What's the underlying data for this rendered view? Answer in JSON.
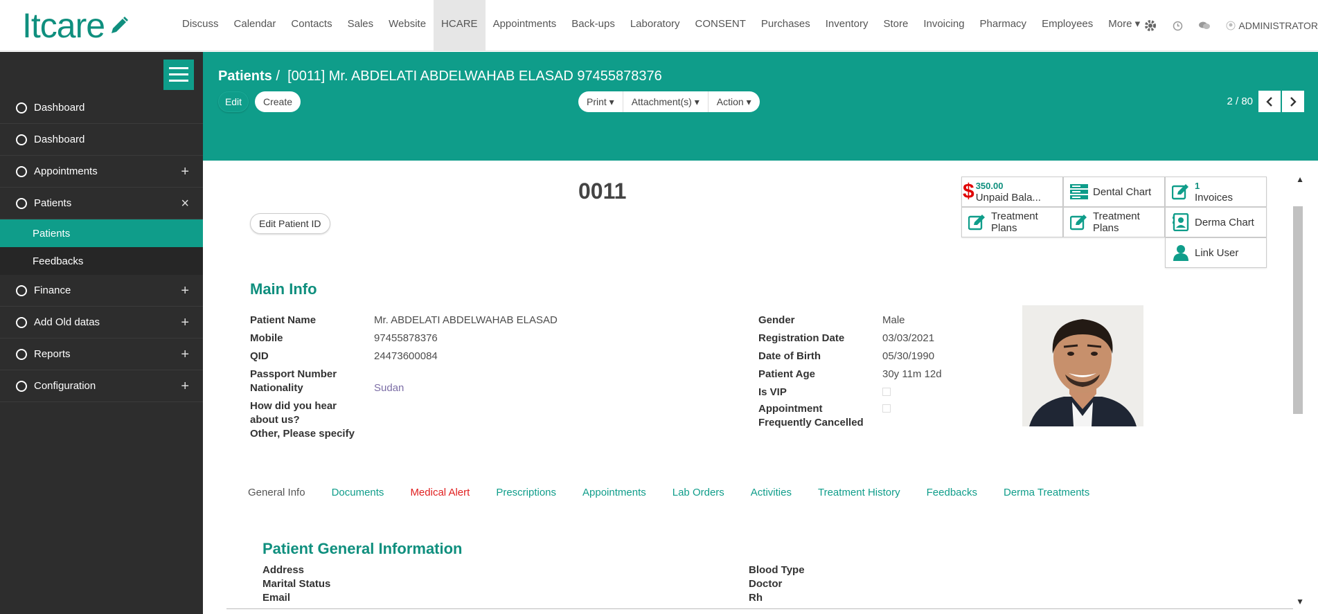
{
  "app": {
    "logo_text": "Itcare"
  },
  "topmenu": [
    "Discuss",
    "Calendar",
    "Contacts",
    "Sales",
    "Website",
    "HCARE",
    "Appointments",
    "Back-ups",
    "Laboratory",
    "CONSENT",
    "Purchases",
    "Inventory",
    "Store",
    "Invoicing",
    "Pharmacy",
    "Employees",
    "More ▾"
  ],
  "topmenu_active": "HCARE",
  "user": {
    "name": "ADMINISTRATOR"
  },
  "sidebar": {
    "items": [
      {
        "label": "Dashboard",
        "toggle": ""
      },
      {
        "label": "Dashboard",
        "toggle": ""
      },
      {
        "label": "Appointments",
        "toggle": "+"
      },
      {
        "label": "Patients",
        "toggle": "×"
      }
    ],
    "sub": [
      {
        "label": "Patients"
      },
      {
        "label": "Feedbacks"
      }
    ],
    "items2": [
      {
        "label": "Finance",
        "toggle": "+"
      },
      {
        "label": "Add Old datas",
        "toggle": "+"
      },
      {
        "label": "Reports",
        "toggle": "+"
      },
      {
        "label": "Configuration",
        "toggle": "+"
      }
    ]
  },
  "header": {
    "crumb_root": "Patients",
    "crumb_sep": "/",
    "crumb_current": "[0011] Mr. ABDELATI ABDELWAHAB ELASAD 97455878376",
    "edit_label": "Edit",
    "create_label": "Create",
    "print_label": "Print ▾",
    "attach_label": "Attachment(s) ▾",
    "action_label": "Action ▾",
    "pager": "2 / 80"
  },
  "record": {
    "patient_id": "0011",
    "edit_pid_label": "Edit Patient ID"
  },
  "smart_buttons": {
    "unpaid_amount": "350.00",
    "unpaid_label": "Unpaid Bala...",
    "dental_chart": "Dental Chart",
    "invoices_count": "1",
    "invoices_label": "Invoices",
    "treatment_plans_1": "Treatment Plans",
    "treatment_plans_2": "Treatment Plans",
    "derma_chart": "Derma Chart",
    "link_user": "Link User"
  },
  "main_info": {
    "title": "Main Info",
    "patient_name_label": "Patient Name",
    "patient_name": "Mr. ABDELATI ABDELWAHAB ELASAD",
    "mobile_label": "Mobile",
    "mobile": "97455878376",
    "qid_label": "QID",
    "qid": "24473600084",
    "passport_label": "Passport Number",
    "nationality_label": "Nationality",
    "nationality": "Sudan",
    "hear_label_1": "How did you hear",
    "hear_label_2": "about us?",
    "other_label": "Other, Please specify",
    "gender_label": "Gender",
    "gender": "Male",
    "reg_date_label": "Registration Date",
    "reg_date": "03/03/2021",
    "dob_label": "Date of Birth",
    "dob": "05/30/1990",
    "age_label": "Patient Age",
    "age": "30y 11m 12d",
    "vip_label": "Is VIP",
    "appt_cancel_label_1": "Appointment",
    "appt_cancel_label_2": "Frequently Cancelled"
  },
  "tabs": [
    "General Info",
    "Documents",
    "Medical Alert",
    "Prescriptions",
    "Appointments",
    "Lab Orders",
    "Activities",
    "Treatment History",
    "Feedbacks",
    "Derma Treatments"
  ],
  "general": {
    "title": "Patient General Information",
    "address_label": "Address",
    "marital_label": "Marital Status",
    "email_label": "Email",
    "blood_label": "Blood Type",
    "doctor_label": "Doctor",
    "rh_label": "Rh"
  },
  "colors": {
    "brand": "#0f9d8a",
    "sidebar": "#2d2d2d",
    "alert": "#e02020",
    "money": "#e00000"
  }
}
